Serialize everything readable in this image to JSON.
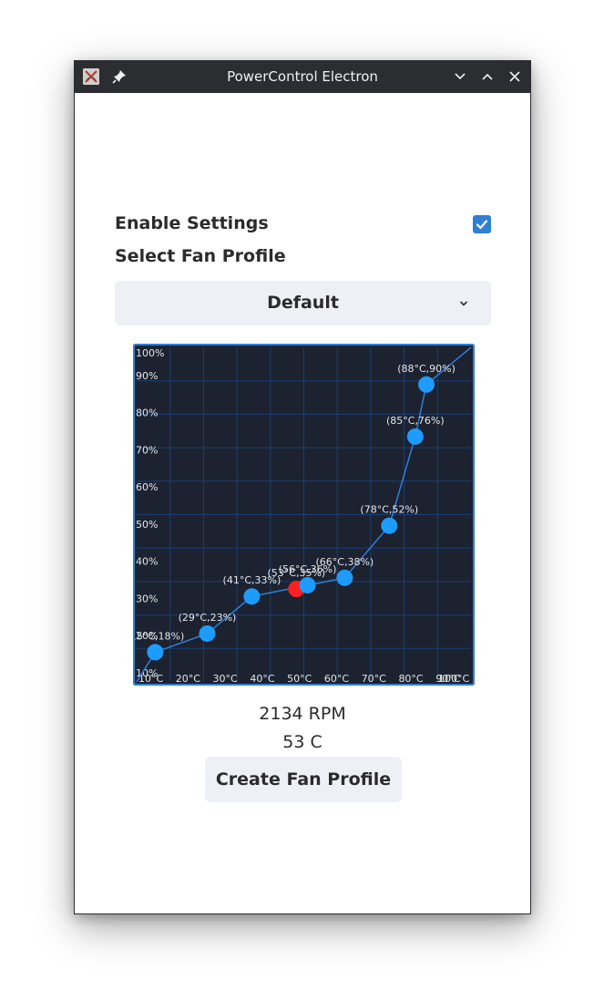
{
  "window": {
    "title": "PowerControl Electron"
  },
  "settings": {
    "enable_label": "Enable Settings",
    "enable_checked": true,
    "profile_label": "Select Fan Profile",
    "profile_selected": "Default"
  },
  "chart_data": {
    "type": "line",
    "title": "",
    "xlabel": "",
    "ylabel": "",
    "xlim": [
      10,
      100
    ],
    "ylim": [
      10,
      100
    ],
    "x_ticks": [
      "10°C",
      "20°C",
      "30°C",
      "40°C",
      "50°C",
      "60°C",
      "70°C",
      "80°C",
      "90°C",
      "100°C"
    ],
    "y_ticks": [
      "10%",
      "20%",
      "30%",
      "40%",
      "50%",
      "60%",
      "70%",
      "80%",
      "90%",
      "100%"
    ],
    "grid": true,
    "series": [
      {
        "x": [
          10,
          15,
          29,
          41,
          56,
          66,
          78,
          85,
          88,
          100
        ],
        "y": [
          10,
          18,
          23,
          33,
          36,
          38,
          52,
          76,
          90,
          100
        ]
      }
    ],
    "points": [
      {
        "x": 15,
        "y": 18,
        "label": "(15°C,18%)"
      },
      {
        "x": 29,
        "y": 23,
        "label": "(29°C,23%)"
      },
      {
        "x": 41,
        "y": 33,
        "label": "(41°C,33%)"
      },
      {
        "x": 56,
        "y": 36,
        "label": "(56°C,36%)"
      },
      {
        "x": 66,
        "y": 38,
        "label": "(66°C,38%)"
      },
      {
        "x": 78,
        "y": 52,
        "label": "(78°C,52%)"
      },
      {
        "x": 85,
        "y": 76,
        "label": "(85°C,76%)"
      },
      {
        "x": 88,
        "y": 90,
        "label": "(88°C,90%)"
      }
    ],
    "current": {
      "x": 53,
      "y": 35,
      "label": "(53°C,35%)"
    },
    "colors": {
      "background": "#1c2230",
      "grid": "#1a3f73",
      "border": "#2f7fd6",
      "line": "#2f7fd6",
      "point": "#1e9bff",
      "current": "#ff1f1f",
      "text": "#e6e6e6"
    }
  },
  "status": {
    "rpm": "2134 RPM",
    "temp": "53 C"
  },
  "actions": {
    "create_label": "Create Fan Profile"
  }
}
